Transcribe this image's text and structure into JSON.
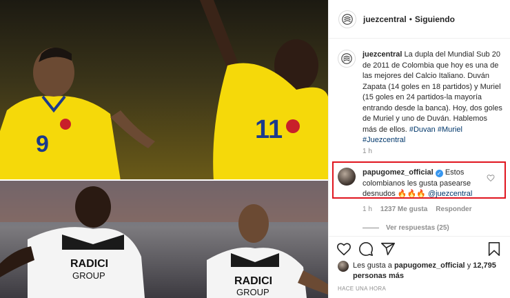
{
  "post": {
    "username": "juezcentral",
    "separator": "•",
    "follow_status": "Siguiendo"
  },
  "caption": {
    "username": "juezcentral",
    "text": "La dupla del Mundial Sub 20 de 2011 de Colombia que hoy es una de las mejores del Calcio Italiano. Duván Zapata (14 goles en 18 partidos) y Muriel (15 goles en 24 partidos-la mayoría entrando desde la banca). Hoy, dos goles de Muriel y uno de Duván. Hablemos más de ellos.",
    "hashtags": "#Duvan #Muriel #Juezcentral",
    "time": "1 h"
  },
  "comment": {
    "username": "papugomez_official",
    "verified_mark": "✓",
    "text": "Estos colombianos les gusta pasearse desnudos",
    "emojis": "🔥🔥🔥",
    "mention": "@juezcentral",
    "time": "1 h",
    "likes": "1237 Me gusta",
    "reply": "Responder",
    "view_replies": "Ver respuestas (25)"
  },
  "likes": {
    "prefix": "Les gusta a",
    "user": "papugomez_official",
    "conj": "y",
    "count": "12,795 personas más"
  },
  "timestamp": "HACE UNA HORA",
  "icons": {
    "like": "heart-icon",
    "comment": "comment-icon",
    "share": "share-icon",
    "save": "bookmark-icon"
  },
  "colors": {
    "accent_link": "#00376b",
    "highlight_box": "#e0141e",
    "verified": "#3897f0",
    "jersey_yellow": "#f5d90a"
  }
}
